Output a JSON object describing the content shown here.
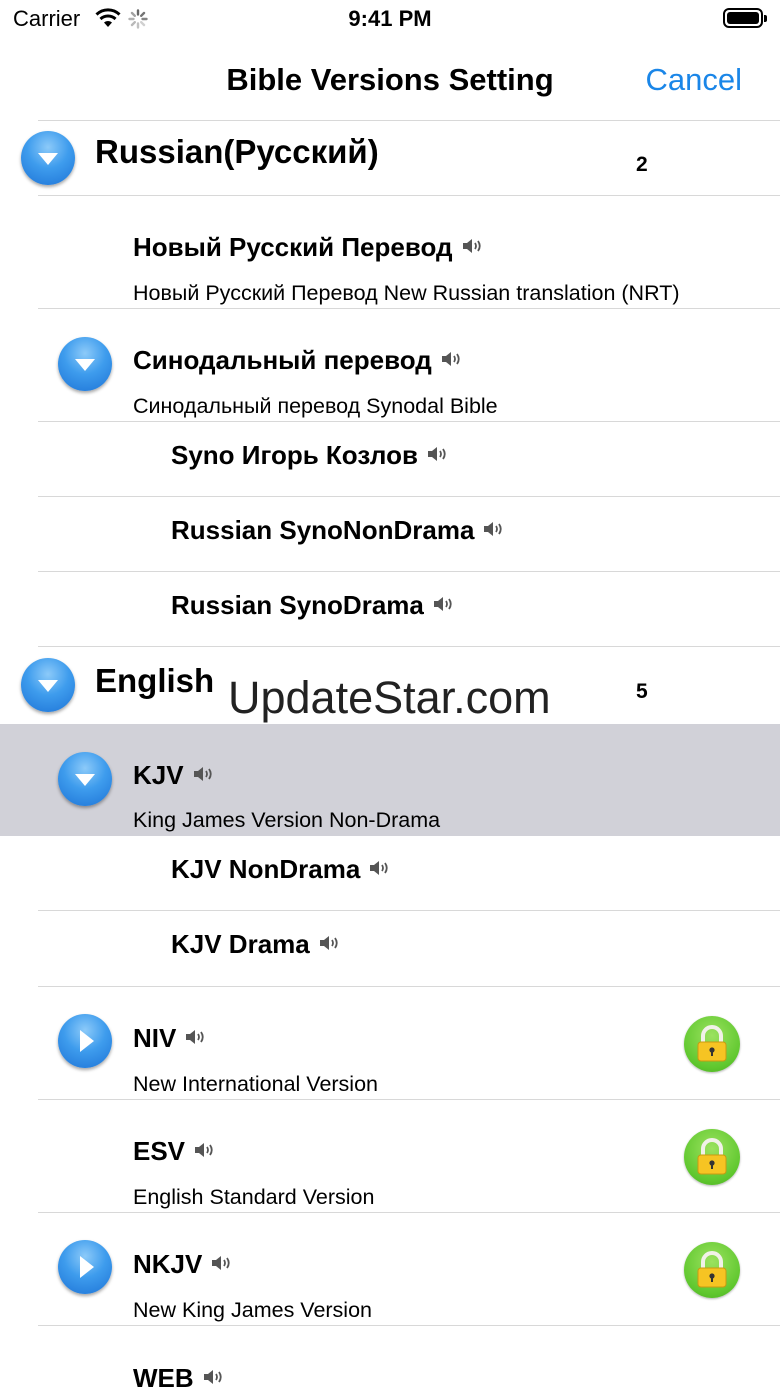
{
  "status_bar": {
    "carrier": "Carrier",
    "time": "9:41 PM"
  },
  "nav": {
    "title": "Bible Versions Setting",
    "cancel_label": "Cancel"
  },
  "watermark": "UpdateStar.com",
  "groups": [
    {
      "title": "Russian(Русский)",
      "count": "2",
      "items": [
        {
          "title": "Новый Русский Перевод",
          "subtitle": "Новый Русский Перевод New Russian translation (NRT)"
        },
        {
          "title": "Синодальный перевод",
          "subtitle": "Синодальный перевод Synodal Bible",
          "children": [
            "Syno Игорь Козлов",
            "Russian SynoNonDrama",
            "Russian SynoDrama"
          ]
        }
      ]
    },
    {
      "title": "English",
      "count": "5",
      "items": [
        {
          "title": "KJV",
          "subtitle": "King James Version Non-Drama",
          "selected": true,
          "children": [
            "KJV NonDrama",
            "KJV Drama"
          ]
        },
        {
          "title": "NIV",
          "subtitle": "New International Version",
          "locked": true
        },
        {
          "title": "ESV",
          "subtitle": "English Standard Version",
          "locked": true
        },
        {
          "title": "NKJV",
          "subtitle": "New King James Version",
          "locked": true
        },
        {
          "title": "WEB",
          "subtitle": ""
        }
      ]
    }
  ],
  "colors": {
    "accent": "#1a86e8",
    "disclosure": "#3e9ced",
    "lock": "#5fc72e",
    "selected_row": "#d1d1d8"
  },
  "icons": {
    "speaker": "speaker-icon",
    "expand": "chevron-down-icon",
    "collapse": "play-icon",
    "lock": "lock-icon"
  }
}
